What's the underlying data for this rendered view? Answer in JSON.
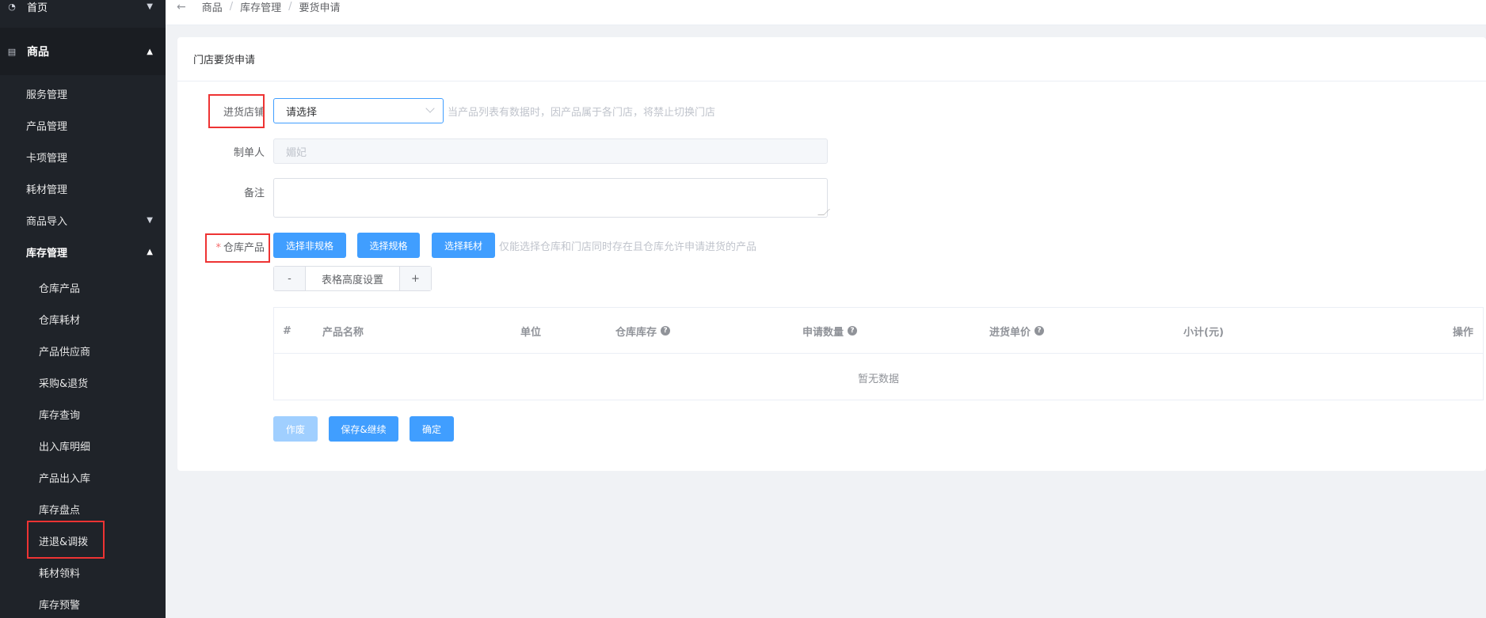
{
  "sidebar": {
    "home_label": "首页",
    "group_label": "商品",
    "items": [
      {
        "label": "服务管理"
      },
      {
        "label": "产品管理"
      },
      {
        "label": "卡项管理"
      },
      {
        "label": "耗材管理"
      },
      {
        "label": "商品导入"
      },
      {
        "label": "库存管理"
      }
    ],
    "sub_items": [
      {
        "label": "仓库产品"
      },
      {
        "label": "仓库耗材"
      },
      {
        "label": "产品供应商"
      },
      {
        "label": "采购&退货"
      },
      {
        "label": "库存查询"
      },
      {
        "label": "出入库明细"
      },
      {
        "label": "产品出入库"
      },
      {
        "label": "库存盘点"
      },
      {
        "label": "进退&调拨"
      },
      {
        "label": "耗材领料"
      },
      {
        "label": "库存预警"
      }
    ]
  },
  "breadcrumb": [
    "商品",
    "库存管理",
    "要货申请"
  ],
  "card": {
    "title": "门店要货申请"
  },
  "form": {
    "store_label": "进货店铺",
    "store_placeholder": "请选择",
    "store_hint": "当产品列表有数据时，因产品属于各门店，将禁止切换门店",
    "maker_label": "制单人",
    "maker_value": "媚妃",
    "remark_label": "备注",
    "products_label": "仓库产品",
    "btn_non_spec": "选择非规格",
    "btn_spec": "选择规格",
    "btn_consumable": "选择耗材",
    "products_hint": "仅能选择仓库和门店同时存在且仓库允许申请进货的产品",
    "stepper": {
      "minus": "-",
      "label": "表格高度设置",
      "plus": "+"
    }
  },
  "table": {
    "columns": [
      "#",
      "产品名称",
      "单位",
      "仓库库存",
      "申请数量",
      "进货单价",
      "小计(元)",
      "操作"
    ],
    "empty_text": "暂无数据"
  },
  "actions": {
    "void": "作废",
    "save_continue": "保存&继续",
    "confirm": "确定"
  },
  "colors": {
    "primary": "#409eff",
    "primary_disabled": "#a0cfff",
    "sidebar_bg": "#1f2329",
    "highlight_border": "#e33"
  }
}
